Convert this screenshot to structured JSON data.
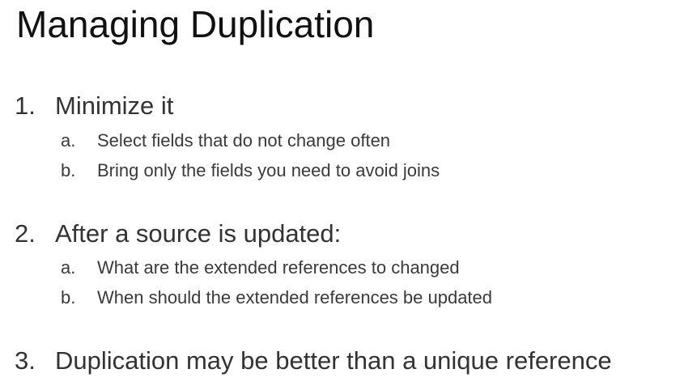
{
  "slide": {
    "title": "Managing Duplication",
    "items": [
      {
        "number": "1.",
        "text": "Minimize it",
        "subitems": [
          {
            "letter": "a.",
            "text": "Select fields that do not change often"
          },
          {
            "letter": "b.",
            "text": "Bring only the fields you need to avoid joins"
          }
        ]
      },
      {
        "number": "2.",
        "text": "After a source is updated:",
        "subitems": [
          {
            "letter": "a.",
            "text": "What are the extended references to changed"
          },
          {
            "letter": "b.",
            "text": "When should the extended references be updated"
          }
        ]
      },
      {
        "number": "3.",
        "text": "Duplication may be better than a unique reference",
        "subitems": []
      }
    ]
  }
}
